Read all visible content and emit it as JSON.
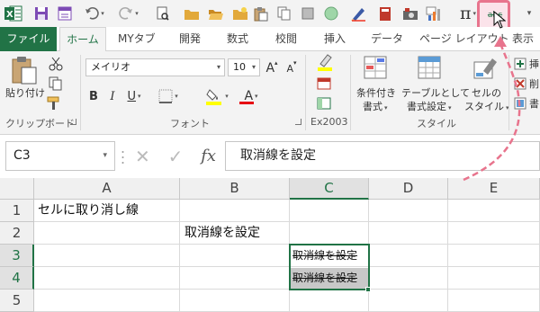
{
  "colors": {
    "accent": "#217346",
    "highlight": "#e8748d",
    "font_color_bar": "#e60012",
    "fill_color_bar": "#ffff00"
  },
  "qat": {
    "icons": [
      "excel-logo-icon",
      "save-icon",
      "form-icon",
      "undo-icon",
      "redo-icon",
      "print-preview-icon",
      "folder-icon",
      "folder-open-icon",
      "new-document-icon",
      "paste-icon",
      "circle-icon",
      "pen-icon",
      "red-book-icon",
      "camera-icon",
      "chart-icon"
    ],
    "pi_symbol": "π",
    "strikethrough_button_label": "abc"
  },
  "tabs": [
    "ファイル",
    "ホーム",
    "MYタブ",
    "開発",
    "数式",
    "校閲",
    "挿入",
    "データ",
    "ページ レイアウト",
    "表示"
  ],
  "ribbon": {
    "clipboard": {
      "paste_label": "貼り付け",
      "group_label": "クリップボード"
    },
    "font": {
      "font_name": "メイリオ",
      "font_size": "10",
      "bold": "B",
      "italic": "I",
      "underline": "U",
      "grow": "A",
      "shrink": "A",
      "font_color_letter": "A",
      "group_label": "フォント"
    },
    "ex2003": {
      "group_label": "Ex2003"
    },
    "styles": {
      "conditional_line1": "条件付き",
      "conditional_line2": "書式",
      "table_line1": "テーブルとして",
      "table_line2": "書式設定",
      "cell_line1": "セルの",
      "cell_line2": "スタイル",
      "group_label": "スタイル"
    },
    "cells": {
      "insert": "挿",
      "delete": "削",
      "format": "書"
    }
  },
  "formula_bar": {
    "name_box": "C3",
    "formula": "取消線を設定",
    "fx": "fx"
  },
  "grid": {
    "columns": [
      "A",
      "B",
      "C",
      "D",
      "E"
    ],
    "rows": [
      "1",
      "2",
      "3",
      "4",
      "5"
    ],
    "cells": {
      "A1": "セルに取り消し線",
      "B2": "取消線を設定",
      "C3": "取消線を設定",
      "C4": "取消線を設定"
    }
  }
}
